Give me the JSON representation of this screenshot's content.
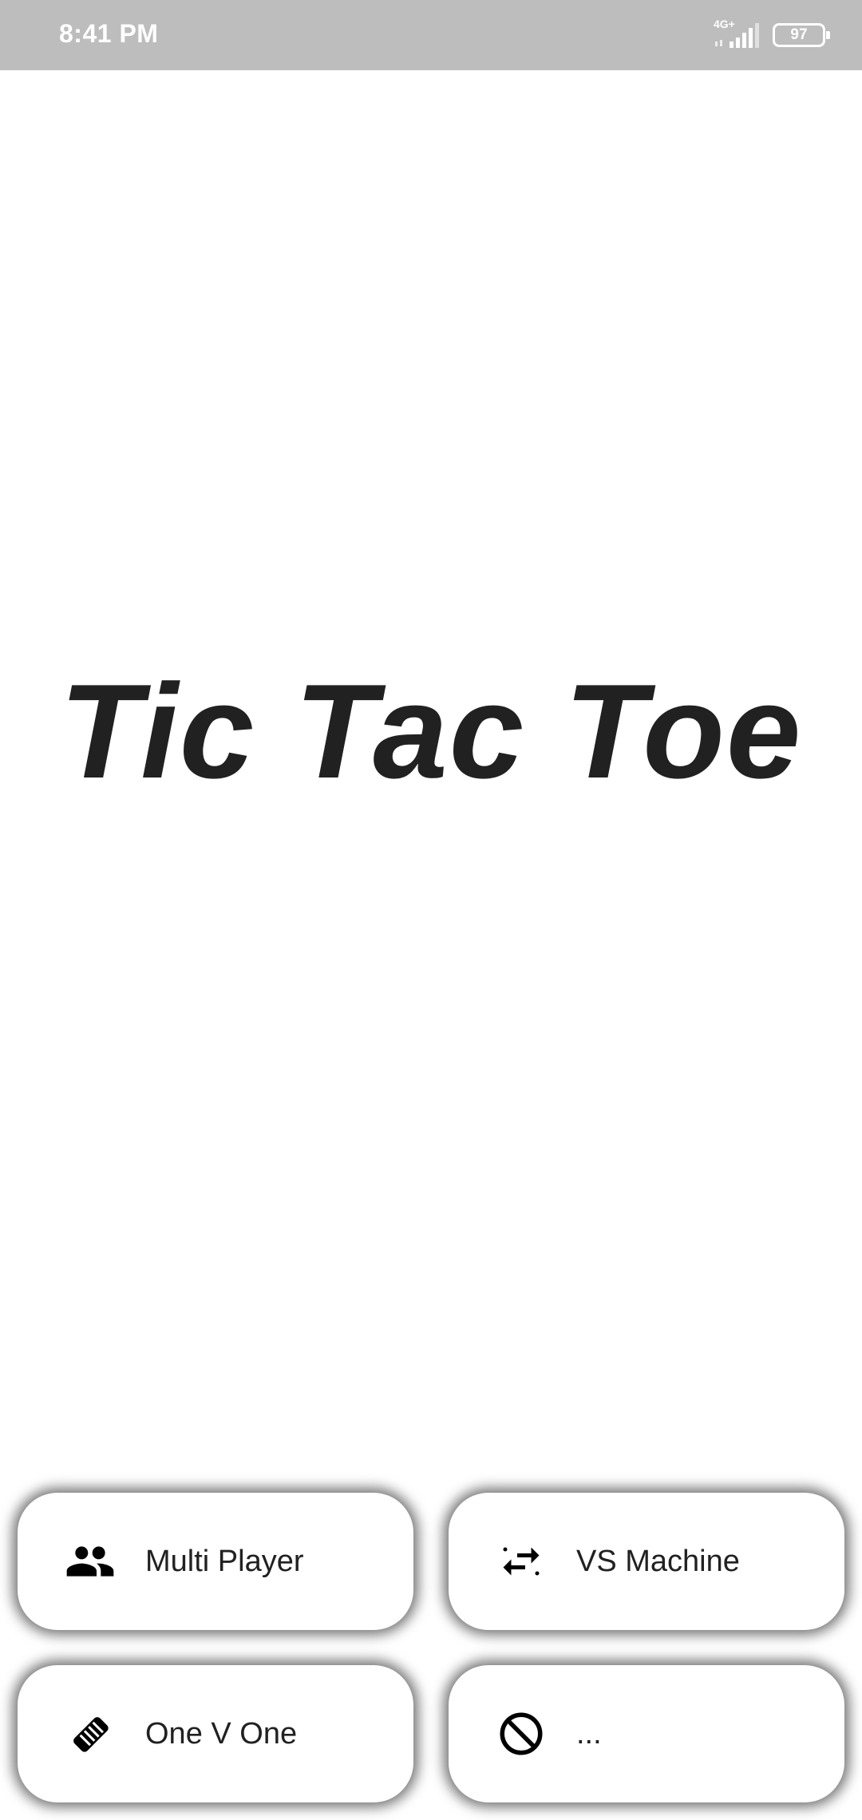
{
  "status_bar": {
    "time": "8:41 PM",
    "network_type": "4G+",
    "battery_level": "97",
    "icons": [
      "signal-icon",
      "battery-icon"
    ]
  },
  "app": {
    "title": "Tic Tac Toe"
  },
  "menu": {
    "buttons": [
      {
        "label": "Multi Player",
        "icon": "people-icon"
      },
      {
        "label": "VS Machine",
        "icon": "swap-arrows-icon"
      },
      {
        "label": "One V One",
        "icon": "handshake-icon"
      },
      {
        "label": "...",
        "icon": "block-icon"
      }
    ]
  },
  "colors": {
    "status_bar_bg": "#bdbdbd",
    "title_text": "#212121",
    "button_bg": "#ffffff",
    "icon": "#000000"
  }
}
